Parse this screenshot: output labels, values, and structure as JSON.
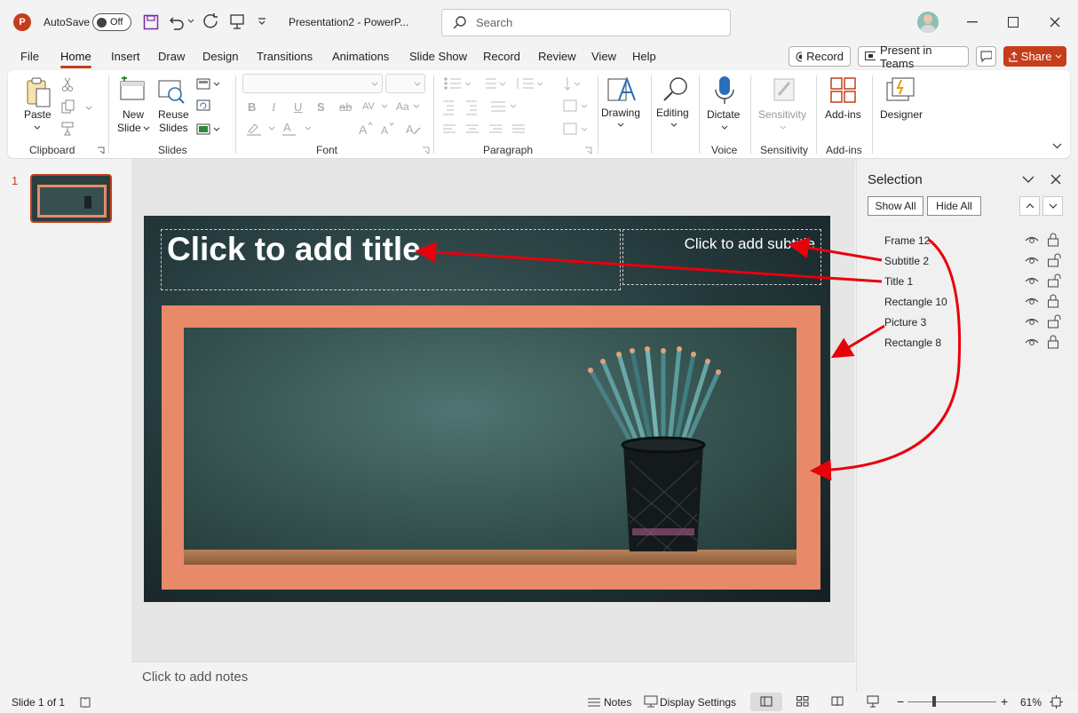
{
  "titlebar": {
    "autosave_label": "AutoSave",
    "autosave_state": "Off",
    "doc_title": "Presentation2 - PowerP...",
    "search_placeholder": "Search"
  },
  "tabs": [
    "File",
    "Home",
    "Insert",
    "Draw",
    "Design",
    "Transitions",
    "Animations",
    "Slide Show",
    "Record",
    "Review",
    "View",
    "Help"
  ],
  "header_buttons": {
    "record": "Record",
    "present": "Present in Teams",
    "share": "Share"
  },
  "ribbon": {
    "clipboard": {
      "paste": "Paste",
      "group": "Clipboard"
    },
    "slides": {
      "new_slide_1": "New",
      "new_slide_2": "Slide",
      "reuse_1": "Reuse",
      "reuse_2": "Slides",
      "group": "Slides"
    },
    "font": {
      "group": "Font",
      "bold": "B",
      "italic": "I",
      "underline": "U",
      "shadow": "S",
      "strike": "ab"
    },
    "paragraph": {
      "group": "Paragraph"
    },
    "drawing": "Drawing",
    "editing": "Editing",
    "dictate": "Dictate",
    "voice_group": "Voice",
    "sensitivity": "Sensitivity",
    "sensitivity_group": "Sensitivity",
    "addins": "Add-ins",
    "addins_group": "Add-ins",
    "designer": "Designer"
  },
  "slide_panel": {
    "number": "1"
  },
  "slide": {
    "title_placeholder": "Click to add title",
    "subtitle_placeholder": "Click to add subtitle",
    "frame_color": "#e8896a"
  },
  "notes_placeholder": "Click to add notes",
  "selection_pane": {
    "title": "Selection",
    "show_all": "Show All",
    "hide_all": "Hide All",
    "items": [
      {
        "name": "Frame 12",
        "lock": "locked"
      },
      {
        "name": "Subtitle 2",
        "lock": "unlocked"
      },
      {
        "name": "Title 1",
        "lock": "unlocked"
      },
      {
        "name": "Rectangle 10",
        "lock": "locked"
      },
      {
        "name": "Picture 3",
        "lock": "unlocked"
      },
      {
        "name": "Rectangle 8",
        "lock": "locked"
      }
    ]
  },
  "statusbar": {
    "slide_info": "Slide 1 of 1",
    "notes": "Notes",
    "display_settings": "Display Settings",
    "zoom": "61%"
  },
  "colors": {
    "accent": "#c43e1c",
    "annotation_arrow": "#e8000b"
  }
}
